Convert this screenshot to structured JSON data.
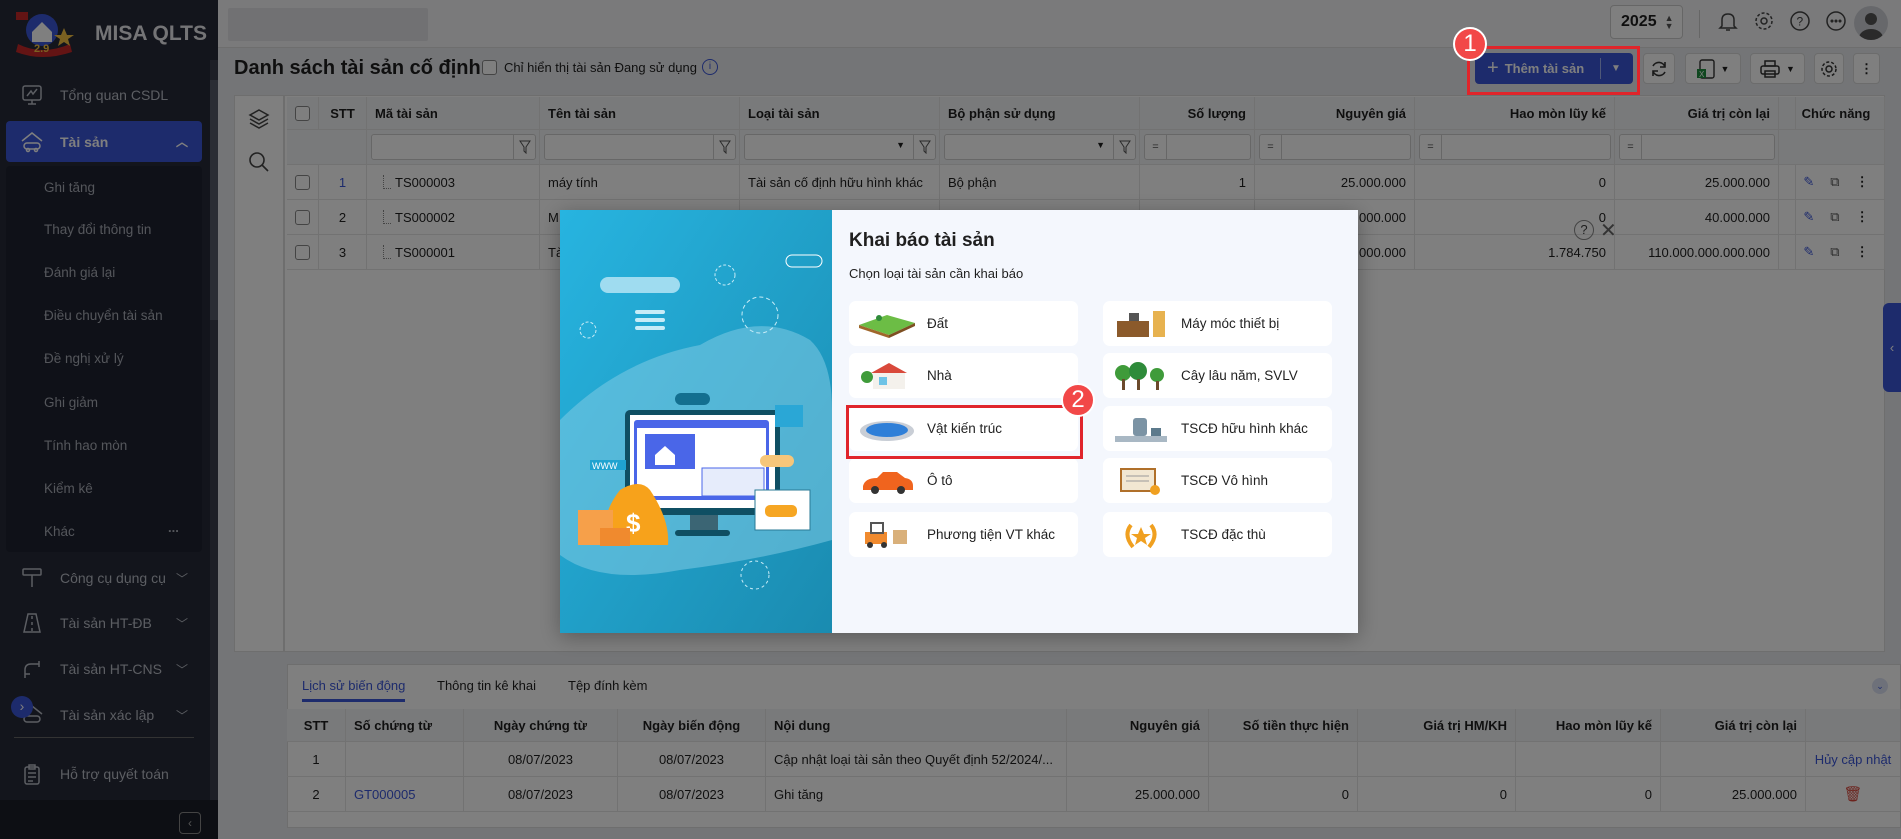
{
  "app": {
    "name": "MISA QLTS",
    "year": "2025"
  },
  "sidebar": {
    "items": [
      {
        "label": "Tổng quan CSDL"
      },
      {
        "label": "Tài sản"
      },
      {
        "label": "Công cụ dụng cụ"
      },
      {
        "label": "Tài sản HT-ĐB"
      },
      {
        "label": "Tài sản HT-CNS"
      },
      {
        "label": "Tài sản xác lập"
      },
      {
        "label": "Hỗ trợ quyết toán"
      }
    ],
    "sub_items": [
      "Ghi tăng",
      "Thay đổi thông tin",
      "Đánh giá lại",
      "Điều chuyển tài sản",
      "Đề nghị xử lý",
      "Ghi giảm",
      "Tính hao mòn",
      "Kiểm kê",
      "Khác"
    ],
    "more": "..."
  },
  "page": {
    "title": "Danh sách tài sản cố định",
    "filter_checkbox_label": "Chỉ hiển thị tài sản Đang sử dụng",
    "add_button": "Thêm tài sản"
  },
  "table": {
    "headers": [
      "STT",
      "Mã tài sản",
      "Tên tài sản",
      "Loại tài sản",
      "Bộ phận sử dụng",
      "Số lượng",
      "Nguyên giá",
      "Hao mòn lũy kế",
      "Giá trị còn lại",
      "Chức năng"
    ],
    "filter_operator": "=",
    "rows": [
      [
        "1",
        "TS000003",
        "máy tính",
        "Tài sản cố định hữu hình khác",
        "Bộ phận",
        "1",
        "25.000.000",
        "0",
        "25.000.000"
      ],
      [
        "2",
        "TS000002",
        "M",
        "",
        "",
        "",
        "40.000.000",
        "0",
        "40.000.000"
      ],
      [
        "3",
        "TS000001",
        "Tà",
        "",
        "",
        "",
        ".000.000",
        "1.784.750",
        "110.000.000.000.000"
      ]
    ]
  },
  "detail": {
    "tabs": [
      "Lịch sử biến động",
      "Thông tin kê khai",
      "Tệp đính kèm"
    ],
    "headers": [
      "STT",
      "Số chứng từ",
      "Ngày chứng từ",
      "Ngày biến động",
      "Nội dung",
      "Nguyên giá",
      "Số tiền thực hiện",
      "Giá trị HM/KH",
      "Hao mòn lũy kế",
      "Giá trị còn lại"
    ],
    "rows": [
      [
        "1",
        "",
        "08/07/2023",
        "08/07/2023",
        "Cập nhật loại tài sản theo Quyết định 52/2024/...",
        "",
        "",
        "",
        "",
        ""
      ],
      [
        "2",
        "GT000005",
        "08/07/2023",
        "08/07/2023",
        "Ghi tăng",
        "25.000.000",
        "0",
        "0",
        "0",
        "25.000.000"
      ]
    ],
    "row1_action": "Hủy cập nhật"
  },
  "modal": {
    "title": "Khai báo tài sản",
    "subtitle": "Chọn loại tài sản cần khai báo",
    "options": [
      {
        "label": "Đất",
        "icon": "land-icon"
      },
      {
        "label": "Máy móc thiết bị",
        "icon": "machinery-icon"
      },
      {
        "label": "Nhà",
        "icon": "house-icon"
      },
      {
        "label": "Cây lâu năm, SVLV",
        "icon": "trees-icon"
      },
      {
        "label": "Vật kiến trúc",
        "icon": "pool-icon"
      },
      {
        "label": "TSCĐ hữu hình khác",
        "icon": "robot-icon"
      },
      {
        "label": "Ô tô",
        "icon": "car-icon"
      },
      {
        "label": "TSCĐ Vô hình",
        "icon": "certificate-icon"
      },
      {
        "label": "Phương tiện VT khác",
        "icon": "forklift-icon"
      },
      {
        "label": "TSCĐ đặc thù",
        "icon": "laurel-star-icon"
      }
    ]
  },
  "annotations": [
    "1",
    "2"
  ],
  "colors": {
    "accent": "#3b56d9",
    "annotation": "#e0252b",
    "sidebar": "#262b38"
  }
}
